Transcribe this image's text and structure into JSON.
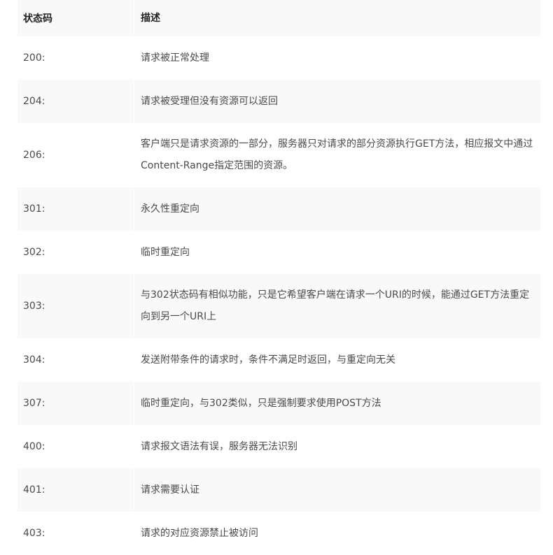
{
  "table": {
    "headers": {
      "code": "状态码",
      "desc": "描述"
    },
    "rows": [
      {
        "code": "200:",
        "desc": "请求被正常处理"
      },
      {
        "code": "204:",
        "desc": "请求被受理但没有资源可以返回"
      },
      {
        "code": "206:",
        "desc": "客户端只是请求资源的一部分，服务器只对请求的部分资源执行GET方法，相应报文中通过Content-Range指定范围的资源。"
      },
      {
        "code": "301:",
        "desc": "永久性重定向"
      },
      {
        "code": "302:",
        "desc": "临时重定向"
      },
      {
        "code": "303:",
        "desc": "与302状态码有相似功能，只是它希望客户端在请求一个URI的时候，能通过GET方法重定向到另一个URI上"
      },
      {
        "code": "304:",
        "desc": "发送附带条件的请求时，条件不满足时返回，与重定向无关"
      },
      {
        "code": "307:",
        "desc": "临时重定向，与302类似，只是强制要求使用POST方法"
      },
      {
        "code": "400:",
        "desc": "请求报文语法有误，服务器无法识别"
      },
      {
        "code": "401:",
        "desc": "请求需要认证"
      },
      {
        "code": "403:",
        "desc": "请求的对应资源禁止被访问"
      }
    ]
  }
}
